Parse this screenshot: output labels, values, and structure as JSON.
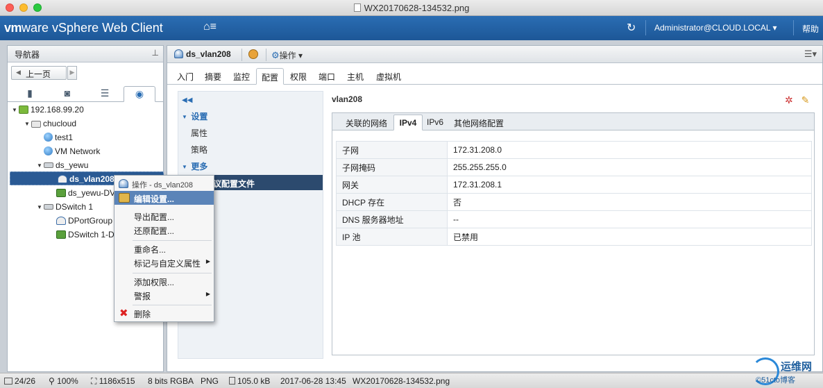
{
  "window": {
    "file_title": "WX20170628-134532.png"
  },
  "header": {
    "brand_vm": "vm",
    "brand_ware": "ware",
    "brand_product": " vSphere Web Client",
    "home_label": "⌂≡",
    "refresh_icon": "↻",
    "user": "Administrator@CLOUD.LOCAL ▾",
    "help": "帮助"
  },
  "navigator": {
    "title": "导航器",
    "back_label": "上一页",
    "tree": {
      "host": "192.168.99.20",
      "datacenter": "chucloud",
      "net1": "test1",
      "net2": "VM Network",
      "switch1": "ds_yewu",
      "pg_selected": "ds_vlan208",
      "uplink1": "ds_yewu-DV",
      "switch2": "DSwitch 1",
      "pg2": "DPortGroup",
      "uplink2": "DSwitch 1-D"
    }
  },
  "main": {
    "object_title": "ds_vlan208",
    "actions_label": "操作 ▾",
    "tabs": [
      "入门",
      "摘要",
      "监控",
      "配置",
      "权限",
      "端口",
      "主机",
      "虚拟机"
    ],
    "active_tab": "配置"
  },
  "settings": {
    "group_settings": "设置",
    "item_properties": "属性",
    "item_policies": "策略",
    "group_more": "更多",
    "selected_item": "议配置文件"
  },
  "details": {
    "title": "vlan208",
    "subtabs": [
      "关联的网络",
      "IPv4",
      "IPv6",
      "其他网络配置"
    ],
    "active_subtab": "IPv4",
    "rows": [
      {
        "key": "子网",
        "value": "172.31.208.0"
      },
      {
        "key": "子网掩码",
        "value": "255.255.255.0"
      },
      {
        "key": "网关",
        "value": "172.31.208.1"
      },
      {
        "key": "DHCP 存在",
        "value": "否"
      },
      {
        "key": "DNS 服务器地址",
        "value": "--"
      },
      {
        "key": "IP 池",
        "value": "已禁用"
      }
    ]
  },
  "context_menu": {
    "header": "操作 - ds_vlan208",
    "edit": "编辑设置...",
    "export": "导出配置...",
    "restore": "还原配置...",
    "rename": "重命名...",
    "tags": "标记与自定义属性",
    "add_permission": "添加权限...",
    "alarms": "警报",
    "delete": "删除"
  },
  "statusbar": {
    "page": "24/26",
    "zoom": "100%",
    "size": "1186x515",
    "depth": "8 bits RGBA",
    "format": "PNG",
    "filesize": "105.0 kB",
    "date": "2017-06-28 13:45",
    "filename": "WX20170628-134532.png"
  },
  "watermark": {
    "name": "运维网",
    "sub": "©51cto博客"
  }
}
